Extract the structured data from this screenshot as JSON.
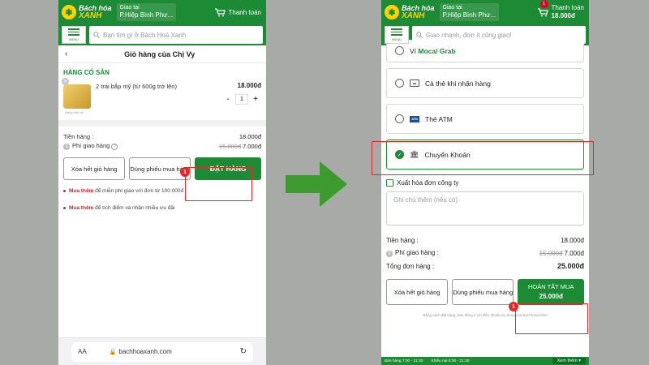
{
  "header": {
    "logo_top": "Bách hóa",
    "logo_bottom": "XANH",
    "delivery_label": "Giao tại",
    "delivery_location": "P.Hiệp Bình Phư...",
    "pay_label": "Thanh toán",
    "menu_label": "MENU"
  },
  "left": {
    "search_placeholder": "Bạn tìm gì ở Bách Hoá Xanh",
    "page_title": "Giỏ hàng của Chị Vy",
    "section_title": "HÀNG CÓ SẴN",
    "item": {
      "name": "2 trái bắp mỹ (từ 600g trở lên)",
      "price": "18.000đ",
      "qty": "1",
      "thumb_caption": "Hàng mới về"
    },
    "subtotal_label": "Tiền hàng :",
    "subtotal_value": "18.000đ",
    "ship_label": "Phí giao hàng",
    "ship_old": "15.000đ",
    "ship_value": "7.000đ",
    "clear_button": "Xóa hết giỏ hàng",
    "voucher_button": "Dùng phiếu mua hàng",
    "order_button": "ĐẶT HÀNG",
    "step": "1",
    "note1_bold": "Mua thêm",
    "note1_text": " để miễn phí giao với đơn từ 100.000đ",
    "note2_bold": "Mua thêm",
    "note2_text": " để tích điểm và nhận nhiều ưu đãi",
    "url_aa": "AA",
    "url": "bachhoaxanh.com"
  },
  "right": {
    "pay_amount": "18.000đ",
    "cart_badge": "1",
    "search_placeholder": "Giao nhanh, đơn ít cũng giao!",
    "wallet_prefix": "Ví",
    "wallet_brand": "Moca/ Grab",
    "opt_cod": "Cà thẻ khi nhận hàng",
    "opt_atm": "Thẻ ATM",
    "opt_transfer": "Chuyển Khoản",
    "atm_icon_text": "ATM",
    "invoice_label": "Xuất hóa đơn công ty",
    "notes_placeholder": "Ghi chú thêm (nếu có)",
    "subtotal_label": "Tiền hàng :",
    "subtotal_value": "18.000đ",
    "ship_label": "Phí giao hàng :",
    "ship_old": "15.000đ",
    "ship_value": "7.000đ",
    "total_label": "Tổng đơn hàng :",
    "total_value": "25.000đ",
    "clear_button": "Xóa hết giỏ hàng",
    "voucher_button": "Dùng phiếu mua hàng",
    "finish_button": "HOÀN TẤT MUA",
    "finish_amount": "25.000đ",
    "step": "1",
    "legal": "Bằng cách đặt hàng, bạn đồng ý với điều khoản sử dụng của BachhoaXANH",
    "hours_sales": "Bán hàng 7:00 - 21:30",
    "hours_complaint": "Khiếu nại 8:00 - 21:30",
    "see_more": "Xem thêm ▾"
  },
  "colors": {
    "brand_green": "#1d8a36",
    "highlight_red": "#e02a2a",
    "arrow_green": "#3d9a2f"
  }
}
